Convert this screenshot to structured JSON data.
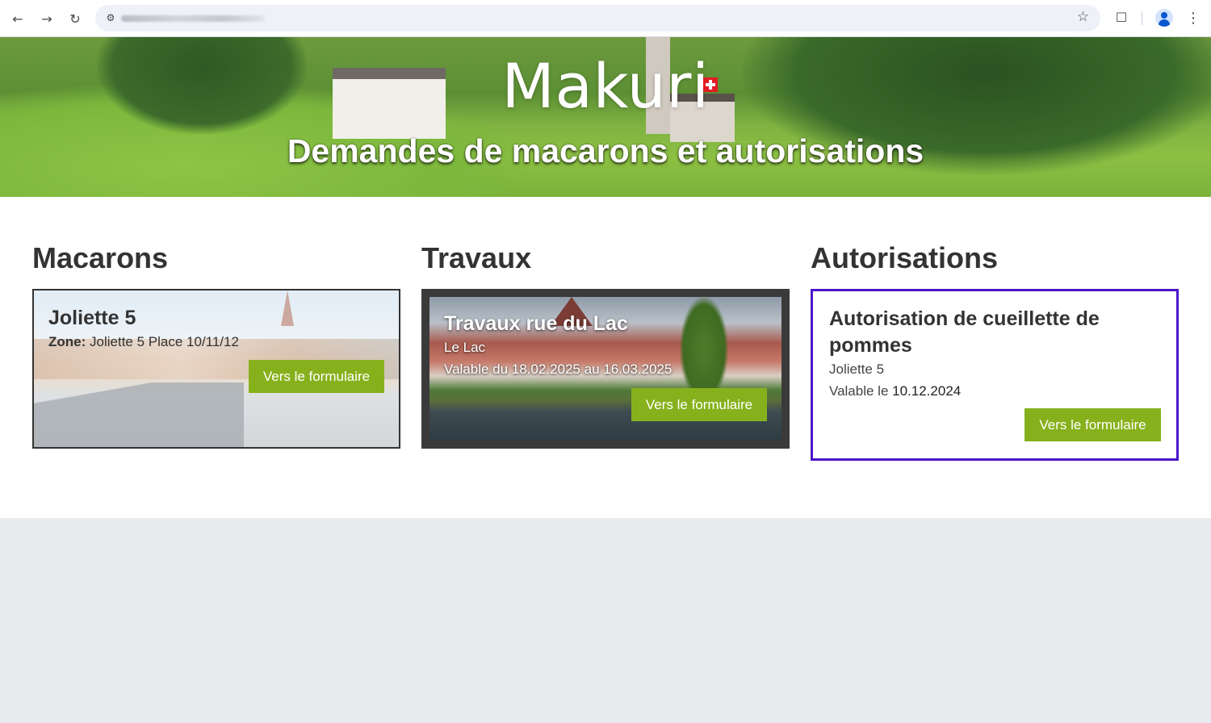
{
  "browser": {
    "back_icon": "arrow-left-icon",
    "forward_icon": "arrow-right-icon",
    "reload_icon": "reload-icon"
  },
  "hero": {
    "brand": "Makuri",
    "subtitle": "Demandes de macarons et autorisations"
  },
  "sections": {
    "macarons": {
      "title": "Macarons",
      "card": {
        "title": "Joliette 5",
        "zone_label": "Zone:",
        "zone_value": "Joliette 5 Place 10/11/12",
        "button": "Vers le formulaire"
      }
    },
    "travaux": {
      "title": "Travaux",
      "card": {
        "title": "Travaux rue du Lac",
        "location": "Le Lac",
        "validity": "Valable du 18.02.2025 au 16.03.2025",
        "button": "Vers le formulaire"
      }
    },
    "autorisations": {
      "title": "Autorisations",
      "card": {
        "title": "Autorisation de cueillette de pommes",
        "location": "Joliette 5",
        "validity_label": "Valable le",
        "validity_date": "10.12.2024",
        "button": "Vers le formulaire"
      }
    }
  },
  "colors": {
    "button": "#87b11c",
    "selected_border": "#4a16c9",
    "title_text": "#333333"
  }
}
